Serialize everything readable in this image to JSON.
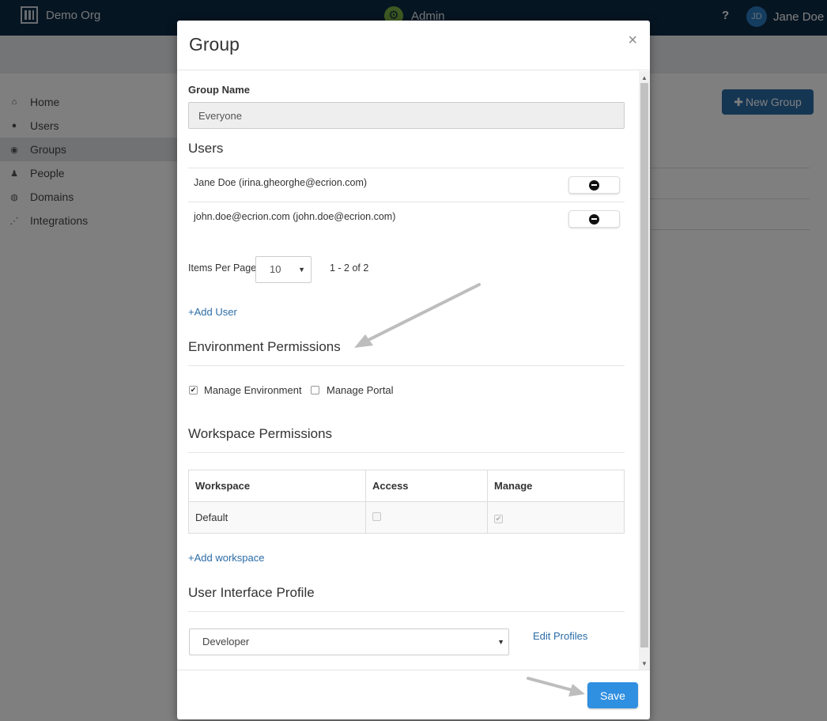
{
  "header": {
    "org_name": "Demo Org",
    "section": "Admin",
    "help": "?",
    "user_initials": "JD",
    "user_name": "Jane Doe"
  },
  "sidebar": {
    "items": [
      {
        "label": "Home",
        "icon": "home-icon"
      },
      {
        "label": "Users",
        "icon": "user-circle-icon"
      },
      {
        "label": "Groups",
        "icon": "group-icon",
        "active": true
      },
      {
        "label": "People",
        "icon": "people-icon"
      },
      {
        "label": "Domains",
        "icon": "globe-icon"
      },
      {
        "label": "Integrations",
        "icon": "share-nodes-icon"
      }
    ]
  },
  "page": {
    "new_group_label": "New Group",
    "new_group_icon": "plus-icon"
  },
  "modal": {
    "title": "Group",
    "close_glyph": "×",
    "group_name_label": "Group Name",
    "group_name_value": "Everyone",
    "users_heading": "Users",
    "users": [
      {
        "text": "Jane Doe (irina.gheorghe@ecrion.com)"
      },
      {
        "text": "john.doe@ecrion.com (john.doe@ecrion.com)"
      }
    ],
    "items_per_page_label": "Items Per Page",
    "items_per_page_value": "10",
    "page_range": "1 - 2 of 2",
    "add_user": "+Add User",
    "env_heading": "Environment Permissions",
    "env_permissions": [
      {
        "label": "Manage Environment",
        "checked": true
      },
      {
        "label": "Manage Portal",
        "checked": false
      }
    ],
    "ws_heading": "Workspace Permissions",
    "ws_columns": [
      "Workspace",
      "Access",
      "Manage"
    ],
    "ws_rows": [
      {
        "workspace": "Default",
        "access": false,
        "manage": true
      }
    ],
    "add_workspace": "+Add workspace",
    "uip_heading": "User Interface Profile",
    "uip_value": "Developer",
    "edit_profiles": "Edit Profiles",
    "save_label": "Save"
  },
  "colors": {
    "topbar": "#0d2a45",
    "primary_button": "#2f8fe0",
    "link": "#2a6ca6"
  }
}
